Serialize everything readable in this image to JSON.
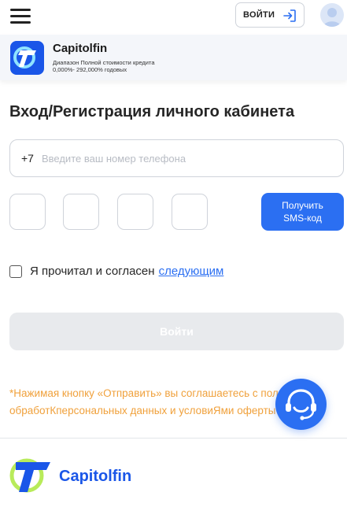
{
  "topbar": {
    "menu_icon": "hamburger-menu-icon",
    "login_label": "ВОЙТИ",
    "login_icon": "sign-in-icon",
    "avatar_icon": "user-avatar-icon"
  },
  "banner": {
    "brand": "Capitolfin",
    "range_label": "Диапазон Полной стоимости кредита",
    "range_value": "0,000%- 292,000% годовых",
    "logo_icon": "capitolfin-logo-icon"
  },
  "form": {
    "title": "Вход/Регистрация личного кабинета",
    "phone_prefix": "+7",
    "phone_placeholder": "Введите ваш номер телефона",
    "phone_value": "",
    "code_boxes": [
      "",
      "",
      "",
      ""
    ],
    "sms_button_line1": "Получить",
    "sms_button_line2": "SMS-код",
    "agree_text": "Я прочитал и согласен",
    "agree_link": "следующим",
    "agree_checked": false,
    "submit_label": "Войти"
  },
  "notice": {
    "text": "*Нажимая кнопку «Отправить» вы соглашаетесь с политикой обработКперсональных данных и условиЯми оферты"
  },
  "support": {
    "icon": "support-headset-icon"
  },
  "footer": {
    "brand": "Capitolfin",
    "logo_icon": "capitolfin-logo-icon"
  },
  "colors": {
    "accent": "#2b6ff2",
    "brand_blue": "#1a56e8",
    "notice": "#f0a13c",
    "disabled_button": "#e8eaed"
  }
}
